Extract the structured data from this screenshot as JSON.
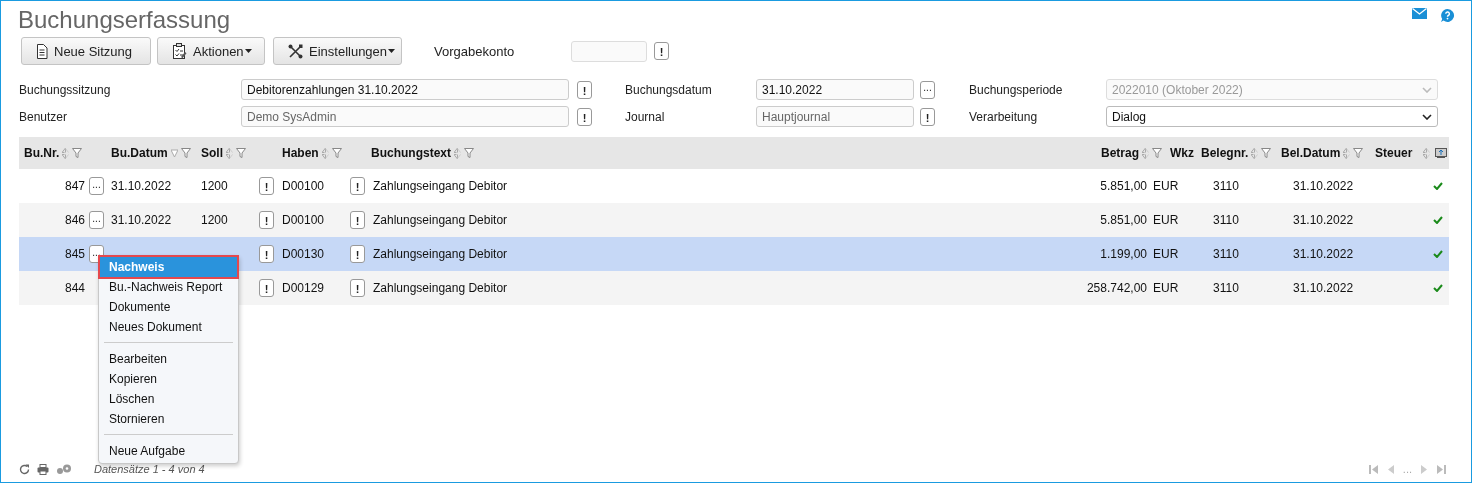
{
  "title": "Buchungserfassung",
  "toolbar": {
    "buttons": [
      {
        "label": "Neue Sitzung",
        "dropdown": false
      },
      {
        "label": "Aktionen",
        "dropdown": true
      },
      {
        "label": "Einstellungen",
        "dropdown": true
      }
    ],
    "default_account": {
      "label": "Vorgabekonto",
      "button": "!"
    }
  },
  "form": {
    "fields": [
      {
        "label": "Buchungssitzung",
        "kind": "text",
        "value": "Debitorenzahlungen 31.10.2022",
        "readonly": false,
        "button": "!"
      },
      {
        "label": "Buchungsdatum",
        "kind": "text",
        "value": "31.10.2022",
        "readonly": false,
        "button": "..."
      },
      {
        "label": "Buchungsperiode",
        "kind": "select",
        "value": "2022010 (Oktober 2022)",
        "disabled": true
      },
      {
        "label": "Benutzer",
        "kind": "text",
        "value": "Demo SysAdmin",
        "readonly": true,
        "button": "!"
      },
      {
        "label": "Journal",
        "kind": "text",
        "value": "Hauptjournal",
        "readonly": true,
        "button": "!"
      },
      {
        "label": "Verarbeitung",
        "kind": "select",
        "value": "Dialog",
        "disabled": false
      }
    ]
  },
  "table": {
    "columns": [
      {
        "label": "Bu.Nr.",
        "sortable": true,
        "descending": false,
        "filter": true
      },
      {
        "label": "Bu.Datum",
        "sortable": true,
        "descending": true,
        "filter": true
      },
      {
        "label": "Soll",
        "sortable": true,
        "descending": false,
        "filter": true
      },
      {
        "label": "Haben",
        "sortable": true,
        "descending": false,
        "filter": true
      },
      {
        "label": "Buchungstext",
        "sortable": true,
        "descending": false,
        "filter": true
      },
      {
        "label": "Betrag",
        "sortable": true,
        "descending": false,
        "filter": true
      },
      {
        "label": "Wkz",
        "sortable": false,
        "filter": false
      },
      {
        "label": "Belegnr.",
        "sortable": true,
        "descending": false,
        "filter": true
      },
      {
        "label": "Bel.Datum",
        "sortable": true,
        "descending": false,
        "filter": true
      },
      {
        "label": "Steuer",
        "sortable": true,
        "descending": false,
        "filter": false
      }
    ],
    "rows": [
      {
        "bu_nr": "847",
        "more": "...",
        "date": "31.10.2022",
        "soll": "1200",
        "soll_button": "!",
        "haben": "D00100",
        "haben_button": "!",
        "text": "Zahlungseingang Debitor",
        "betrag": "5.851,00",
        "wkz": "EUR",
        "belegnr": "3110",
        "bel_datum": "31.10.2022",
        "tax": true,
        "selected": false
      },
      {
        "bu_nr": "846",
        "more": "...",
        "date": "31.10.2022",
        "soll": "1200",
        "soll_button": "!",
        "haben": "D00100",
        "haben_button": "!",
        "text": "Zahlungseingang Debitor",
        "betrag": "5.851,00",
        "wkz": "EUR",
        "belegnr": "3110",
        "bel_datum": "31.10.2022",
        "tax": true,
        "selected": false
      },
      {
        "bu_nr": "845",
        "more": "...",
        "soll_button": "!",
        "haben": "D00130",
        "haben_button": "!",
        "text": "Zahlungseingang Debitor",
        "betrag": "1.199,00",
        "wkz": "EUR",
        "belegnr": "3110",
        "bel_datum": "31.10.2022",
        "tax": true,
        "selected": true
      },
      {
        "bu_nr": "844",
        "haben": "D00129",
        "soll_button": "!",
        "haben_button": "!",
        "text": "Zahlungseingang Debitor",
        "betrag": "258.742,00",
        "wkz": "EUR",
        "belegnr": "3110",
        "bel_datum": "31.10.2022",
        "tax": true,
        "selected": false
      }
    ]
  },
  "context_menu": {
    "groups": [
      [
        {
          "label": "Nachweis",
          "selected": true
        },
        {
          "label": "Bu.-Nachweis Report",
          "selected": false
        },
        {
          "label": "Dokumente",
          "selected": false
        },
        {
          "label": "Neues Dokument",
          "selected": false
        }
      ],
      [
        {
          "label": "Bearbeiten",
          "selected": false
        },
        {
          "label": "Kopieren",
          "selected": false
        },
        {
          "label": "Löschen",
          "selected": false
        },
        {
          "label": "Stornieren",
          "selected": false
        }
      ],
      [
        {
          "label": "Neue Aufgabe",
          "selected": false
        }
      ]
    ]
  },
  "footer": {
    "records": "Datensätze 1 - 4 von 4",
    "pager_text": "..."
  }
}
